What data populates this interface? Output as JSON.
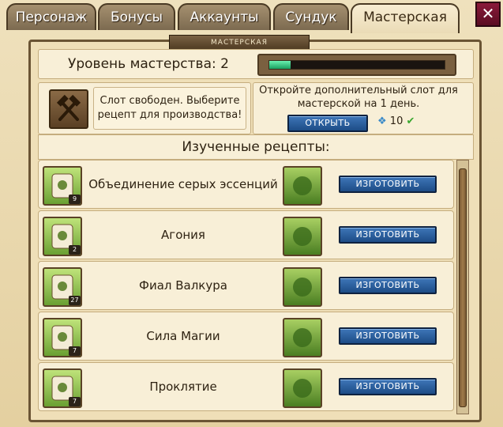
{
  "tabs": [
    {
      "label": "Персонаж"
    },
    {
      "label": "Бонусы"
    },
    {
      "label": "Аккаунты"
    },
    {
      "label": "Сундук"
    },
    {
      "label": "Мастерская"
    }
  ],
  "close_icon": "close-icon",
  "banner": {
    "title": "МАСТЕРСКАЯ"
  },
  "level": {
    "label": "Уровень мастерства: 2",
    "progress": 0.12
  },
  "slot": {
    "text": "Слот свободен. Выберите рецепт для производства!",
    "open_text": "Откройте дополнительный слот для мастерской на 1 день.",
    "open_button": "ОТКРЫТЬ",
    "price": "10"
  },
  "recipes": {
    "header": "Изученные рецепты:",
    "button_label": "ИЗГОТОВИТЬ",
    "items": [
      {
        "qty": "9",
        "name": "Объединение серых эссенций",
        "result_icon": "gray-essence-icon"
      },
      {
        "qty": "2",
        "name": "Агония",
        "result_icon": "horn-icon"
      },
      {
        "qty": "27",
        "name": "Фиал Валкура",
        "result_icon": "flask-icon"
      },
      {
        "qty": "7",
        "name": "Сила Магии",
        "result_icon": "blue-potion-icon"
      },
      {
        "qty": "7",
        "name": "Проклятие",
        "result_icon": "purple-dagger-icon"
      }
    ]
  },
  "colors": {
    "accent_button": "#2a5d9e",
    "progress": "#33cc88"
  }
}
